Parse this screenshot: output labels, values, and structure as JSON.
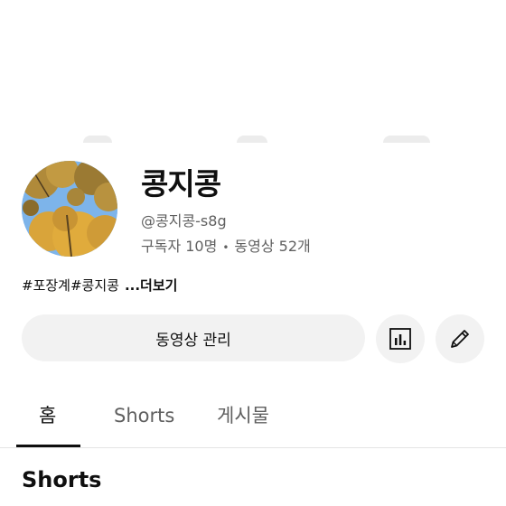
{
  "channel": {
    "name": "콩지콩",
    "handle": "@콩지콩-s8g",
    "subscribers": "구독자 10명",
    "separator": "•",
    "video_count": "동영상 52개",
    "description": "#포장계#콩지콩",
    "more_label": "...더보기",
    "avatar_icon": "autumn-tree-avatar"
  },
  "actions": {
    "manage_videos_label": "동영상 관리",
    "analytics_icon": "bar-chart-icon",
    "edit_icon": "pencil-icon"
  },
  "tabs": [
    {
      "label": "홈",
      "active": true
    },
    {
      "label": "Shorts",
      "active": false
    },
    {
      "label": "게시물",
      "active": false
    }
  ],
  "section": {
    "title": "Shorts"
  },
  "colors": {
    "text_primary": "#0f0f0f",
    "text_secondary": "#606060",
    "button_bg": "#f2f2f2",
    "divider": "#e5e5e5"
  }
}
